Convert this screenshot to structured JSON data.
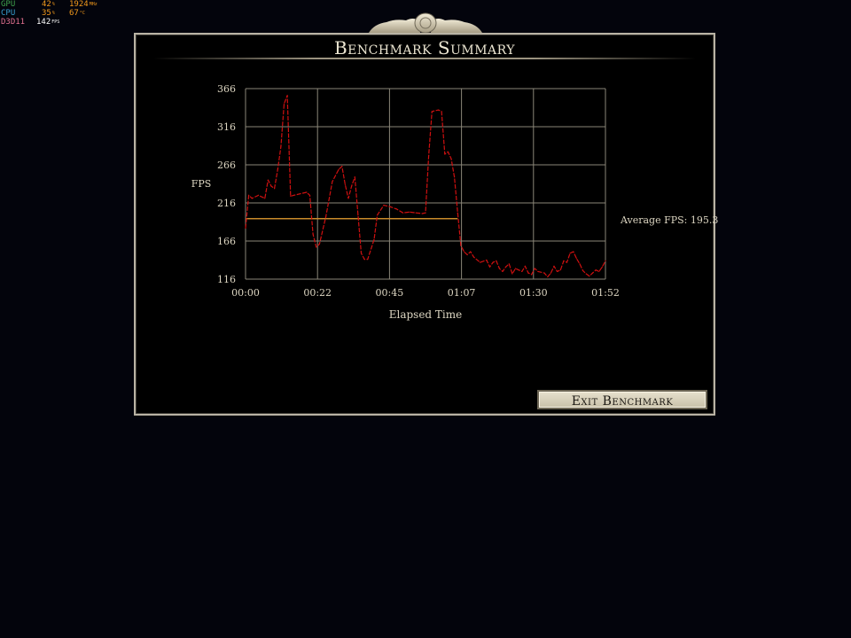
{
  "overlay": {
    "gpu": {
      "label": "GPU",
      "value1": "42",
      "unit1": "%",
      "value2": "1924",
      "unit2": "MHz"
    },
    "cpu": {
      "label": "CPU",
      "value1": "35",
      "unit1": "%",
      "value2": "67",
      "unit2": "°C"
    },
    "ram": {
      "label": "D3D11"
    },
    "fps": {
      "value": "142",
      "unit": "FPS"
    }
  },
  "panel": {
    "title": "Benchmark Summary",
    "average_label": "Average FPS: 195.3",
    "exit_button": "Exit Benchmark"
  },
  "colors": {
    "background": "#03040c",
    "panel_border": "#b9b3a4",
    "line": "#d01010",
    "average_line": "#c98a2a",
    "text": "#ddd6c2"
  },
  "chart_data": {
    "type": "line",
    "ylabel": "FPS",
    "xlabel": "Elapsed Time",
    "y_ticks": [
      116,
      166,
      216,
      266,
      316,
      366
    ],
    "x_ticks": [
      "00:00",
      "00:22",
      "00:45",
      "01:07",
      "01:30",
      "01:52"
    ],
    "xlim_seconds": [
      0,
      112
    ],
    "ylim": [
      116,
      366
    ],
    "grid": true,
    "average_fps": 195.3,
    "average_line_end_seconds": 66,
    "series": [
      {
        "values_by_second": [
          [
            0,
            183
          ],
          [
            1,
            226
          ],
          [
            2,
            222
          ],
          [
            4,
            226
          ],
          [
            6,
            222
          ],
          [
            7,
            246
          ],
          [
            8,
            238
          ],
          [
            9,
            235
          ],
          [
            10,
            260
          ],
          [
            11,
            290
          ],
          [
            12,
            346
          ],
          [
            13,
            357
          ],
          [
            14,
            225
          ],
          [
            15,
            226
          ],
          [
            17,
            228
          ],
          [
            19,
            230
          ],
          [
            20,
            226
          ],
          [
            21,
            175
          ],
          [
            22,
            158
          ],
          [
            23,
            162
          ],
          [
            25,
            198
          ],
          [
            27,
            244
          ],
          [
            29,
            260
          ],
          [
            30,
            264
          ],
          [
            31,
            240
          ],
          [
            32,
            222
          ],
          [
            33,
            238
          ],
          [
            34,
            250
          ],
          [
            35,
            200
          ],
          [
            36,
            150
          ],
          [
            37,
            142
          ],
          [
            38,
            142
          ],
          [
            40,
            168
          ],
          [
            41,
            200
          ],
          [
            43,
            213
          ],
          [
            45,
            211
          ],
          [
            47,
            208
          ],
          [
            49,
            203
          ],
          [
            51,
            204
          ],
          [
            53,
            203
          ],
          [
            55,
            202
          ],
          [
            56,
            203
          ],
          [
            57,
            278
          ],
          [
            58,
            336
          ],
          [
            60,
            338
          ],
          [
            61,
            336
          ],
          [
            62,
            280
          ],
          [
            63,
            283
          ],
          [
            64,
            274
          ],
          [
            65,
            250
          ],
          [
            66,
            203
          ],
          [
            67,
            160
          ],
          [
            68,
            152
          ],
          [
            69,
            148
          ],
          [
            70,
            152
          ],
          [
            71,
            145
          ],
          [
            73,
            138
          ],
          [
            75,
            141
          ],
          [
            76,
            132
          ],
          [
            77,
            138
          ],
          [
            78,
            140
          ],
          [
            79,
            130
          ],
          [
            80,
            126
          ],
          [
            81,
            132
          ],
          [
            82,
            136
          ],
          [
            83,
            123
          ],
          [
            84,
            130
          ],
          [
            85,
            128
          ],
          [
            86,
            126
          ],
          [
            87,
            133
          ],
          [
            88,
            124
          ],
          [
            89,
            122
          ],
          [
            90,
            130
          ],
          [
            91,
            126
          ],
          [
            93,
            124
          ],
          [
            94,
            119
          ],
          [
            95,
            124
          ],
          [
            96,
            133
          ],
          [
            97,
            126
          ],
          [
            98,
            128
          ],
          [
            99,
            140
          ],
          [
            100,
            138
          ],
          [
            101,
            150
          ],
          [
            102,
            152
          ],
          [
            103,
            143
          ],
          [
            104,
            136
          ],
          [
            105,
            127
          ],
          [
            106,
            123
          ],
          [
            107,
            120
          ],
          [
            108,
            124
          ],
          [
            109,
            128
          ],
          [
            110,
            126
          ],
          [
            111,
            132
          ],
          [
            112,
            140
          ]
        ]
      }
    ]
  }
}
